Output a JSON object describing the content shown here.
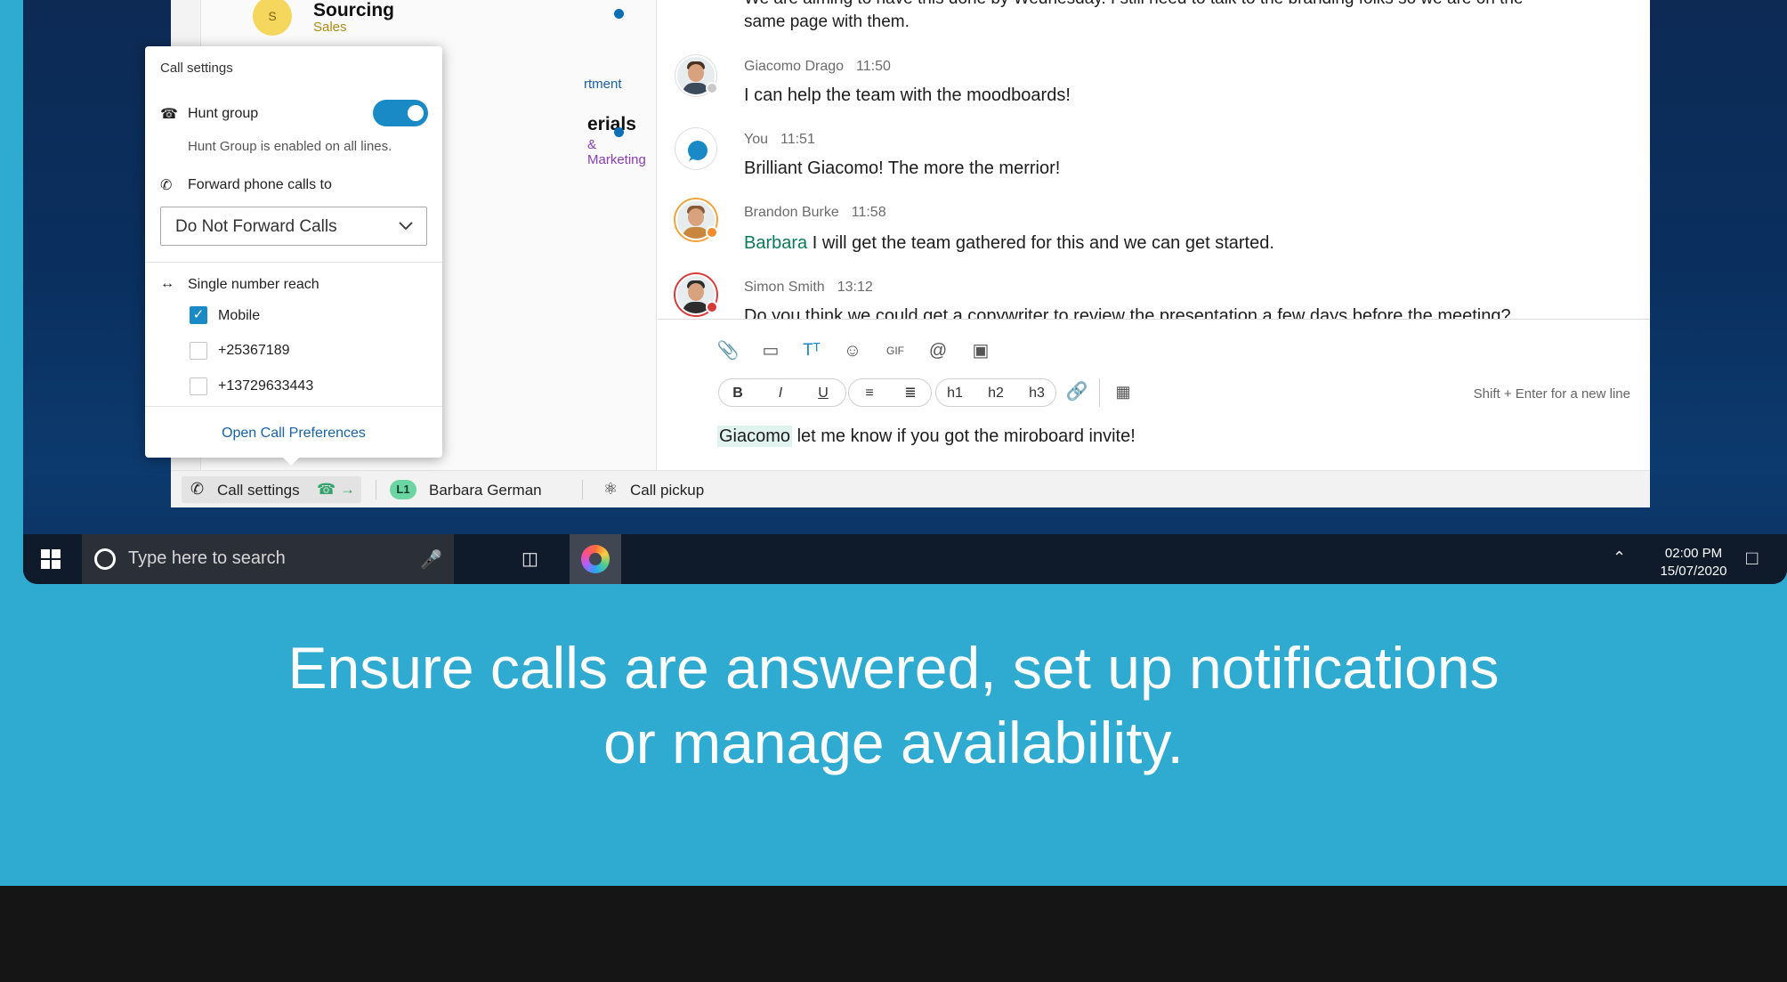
{
  "colors": {
    "page_bg": "#2faad1",
    "footer_bg": "#151515",
    "accent_blue": "#1a8ac7",
    "link_blue": "#1762a8",
    "mention_green": "#0b7a53",
    "lines_badge": "#6bd5a3"
  },
  "spaces": [
    {
      "avatar_letter": "S",
      "name": "Sourcing",
      "subtitle": "Sales",
      "subtitle_color": "#b08a10",
      "unread": true
    },
    {
      "avatar_letter": "",
      "name": "",
      "subtitle": "rtment",
      "subtitle_color": "#1762a8",
      "unread": false
    },
    {
      "avatar_letter": "",
      "name": "erials",
      "subtitle": "& Marketing",
      "subtitle_color": "#8a3db6",
      "unread": true
    }
  ],
  "messages": {
    "partial_top_line1": "We are aiming to have this done by Wednesday. I still need to talk to the branding folks so we are on the",
    "partial_top_line2": "same page with them.",
    "items": [
      {
        "sender": "Giacomo Drago",
        "time": "11:50",
        "text": "I can help the team with the moodboards!",
        "mention": ""
      },
      {
        "sender": "You",
        "time": "11:51",
        "text": "Brilliant Giacomo! The more the merrior!",
        "mention": ""
      },
      {
        "sender": "Brandon Burke",
        "time": "11:58",
        "text": "I will get the team gathered for this and we can get started.",
        "mention": "Barbara"
      },
      {
        "sender": "Simon Smith",
        "time": "13:12",
        "text": "Do you think we could get a copywriter to review the presentation a few days before the meeting?",
        "mention": ""
      }
    ]
  },
  "composer": {
    "toolbar_icons": [
      "attach-icon",
      "share-screen-icon",
      "text-format-icon",
      "emoji-icon",
      "gif-icon",
      "mention-icon",
      "whiteboard-icon"
    ],
    "format_bold": "B",
    "format_italic": "I",
    "format_underline": "U",
    "format_h1": "h1",
    "format_h2": "h2",
    "format_h3": "h3",
    "hint": "Shift + Enter for a new line",
    "draft_mention": "Giacomo",
    "draft_text": " let me know if you got the miroboard invite!"
  },
  "call_settings": {
    "title": "Call settings",
    "hunt_group_label": "Hunt group",
    "hunt_group_on": true,
    "hunt_group_note": "Hunt Group is enabled on all lines.",
    "forward_label": "Forward phone calls to",
    "forward_value": "Do Not Forward Calls",
    "snr_label": "Single number reach",
    "snr_options": [
      {
        "label": "Mobile",
        "checked": true
      },
      {
        "label": "+25367189",
        "checked": false
      },
      {
        "label": "+13729633443",
        "checked": false
      }
    ],
    "prefs_link": "Open Call Preferences"
  },
  "call_bar": {
    "call_settings_label": "Call settings",
    "line_badge": "L1",
    "line_name": "Barbara German",
    "pickup_label": "Call pickup"
  },
  "taskbar": {
    "search_placeholder": "Type here to search",
    "time": "02:00 PM",
    "date": "15/07/2020"
  },
  "caption": {
    "line1": "Ensure calls are answered, set up notifications",
    "line2": "or manage availability."
  }
}
